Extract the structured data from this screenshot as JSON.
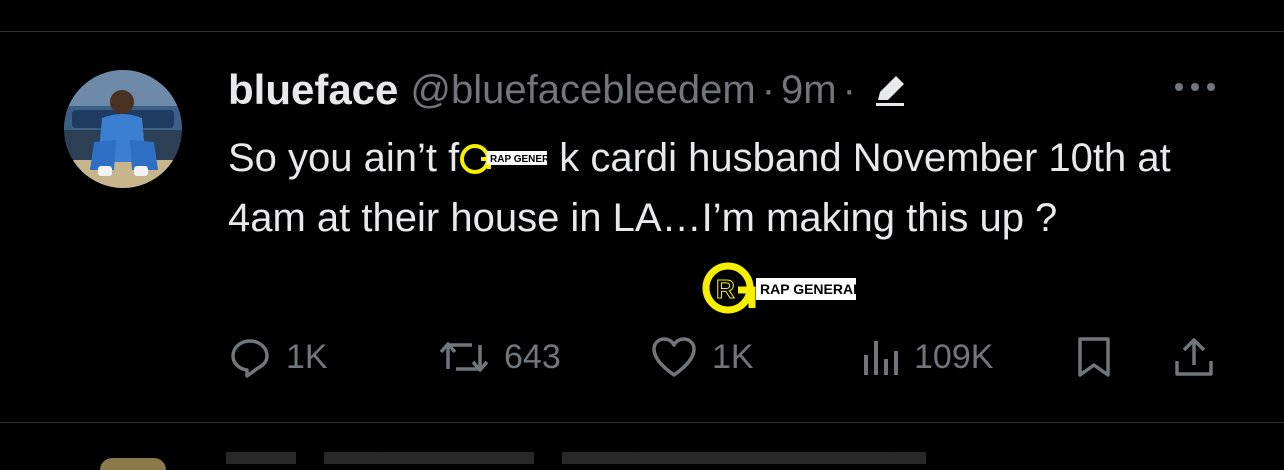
{
  "tweet": {
    "display_name": "blueface",
    "handle": "@bluefacebleedem",
    "separator": "·",
    "time": "9m",
    "text_before_redaction": "So you ain’t f",
    "text_after_redaction": "k cardi husband November 10th at 4am at their house in LA…I’m making this up ?",
    "edit_icon": "pencil-icon",
    "more_icon": "more-horizontal-icon"
  },
  "actions": {
    "reply": {
      "icon": "reply-icon",
      "count": "1K"
    },
    "retweet": {
      "icon": "retweet-icon",
      "count": "643"
    },
    "like": {
      "icon": "heart-icon",
      "count": "1K"
    },
    "views": {
      "icon": "analytics-icon",
      "count": "109K"
    },
    "bookmark": {
      "icon": "bookmark-icon"
    },
    "share": {
      "icon": "share-icon"
    }
  },
  "watermark": {
    "logo_text": "RAP GENERALS",
    "monogram": "RG"
  },
  "colors": {
    "background": "#000000",
    "text_primary": "#e7e9ea",
    "text_secondary": "#71767b",
    "divider": "#2f3336",
    "watermark_yellow": "#f5ef00"
  }
}
